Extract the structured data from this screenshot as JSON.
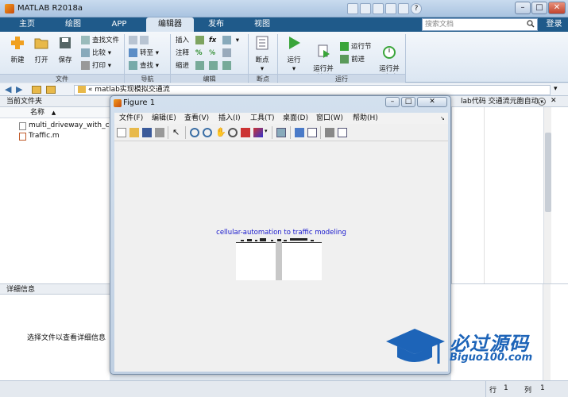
{
  "window": {
    "title": "MATLAB R2018a"
  },
  "tabs": [
    {
      "label": "主页"
    },
    {
      "label": "绘图"
    },
    {
      "label": "APP"
    },
    {
      "label": "编辑器"
    },
    {
      "label": "发布"
    },
    {
      "label": "视图"
    }
  ],
  "search": {
    "placeholder": "搜索文档"
  },
  "login_label": "登录",
  "ribbon": {
    "file": {
      "new": "新建",
      "open": "打开",
      "save": "保存",
      "find_files": "查找文件",
      "compare": "比较",
      "print": "打印",
      "group": "文件"
    },
    "nav": {
      "goto": "转至",
      "find": "查找",
      "group": "导航"
    },
    "edit": {
      "insert": "插入",
      "comment": "注释",
      "indent": "缩进",
      "fx": "fx",
      "group": "编辑"
    },
    "breakpoints": {
      "label": "断点",
      "group": "断点"
    },
    "run": {
      "run": "运行",
      "run_advance": "运行并\n前进",
      "run_section": "运行节",
      "advance": "前进",
      "run_time": "运行并\n计时",
      "group": "运行"
    }
  },
  "address": {
    "separator": "«",
    "path": "matlab实现模拟交通流"
  },
  "current_folder": {
    "header": "当前文件夹",
    "column_name": "名称",
    "sort_indicator": "▲",
    "files": [
      {
        "name": "multi_driveway_with_cro"
      },
      {
        "name": "Traffic.m"
      }
    ]
  },
  "details": {
    "header": "详细信息",
    "message": "选择文件以查看详细信息"
  },
  "editor_panel": {
    "header": "lab代码 交通流元胞自动..."
  },
  "figure": {
    "title": "Figure 1",
    "menus": [
      {
        "label": "文件(F)"
      },
      {
        "label": "编辑(E)"
      },
      {
        "label": "查看(V)"
      },
      {
        "label": "插入(I)"
      },
      {
        "label": "工具(T)"
      },
      {
        "label": "桌面(D)"
      },
      {
        "label": "窗口(W)"
      },
      {
        "label": "帮助(H)"
      }
    ],
    "plot_title": "cellular-automation to traffic modeling"
  },
  "status": {
    "row_label": "行",
    "row": "1",
    "col_label": "列",
    "col": "1"
  },
  "watermark": {
    "text": "必过源码",
    "url": "Biguo100.com"
  },
  "colors": {
    "tab_bar": "#1f5a8a",
    "plot_title": "#1515cc",
    "watermark": "#1d64b8"
  }
}
